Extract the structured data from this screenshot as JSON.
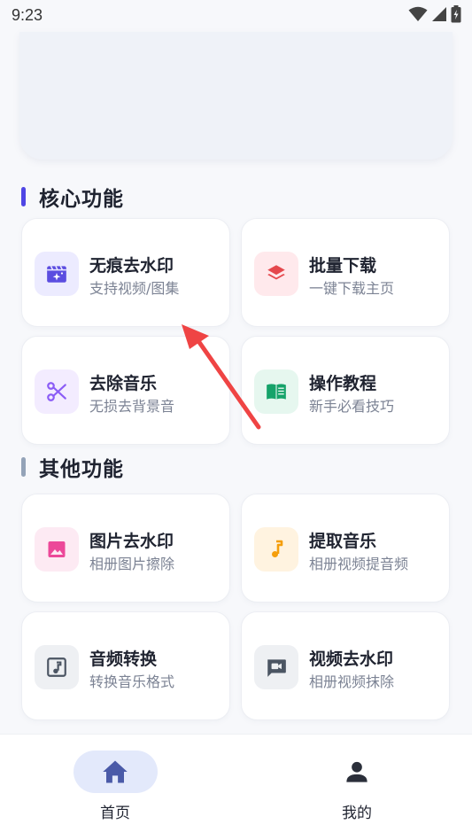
{
  "status_bar": {
    "time": "9:23",
    "icons": [
      "wifi-icon",
      "signal-icon",
      "battery-icon"
    ]
  },
  "sections": {
    "core": {
      "title": "核心功能",
      "accent_color": "#4f46e5"
    },
    "other": {
      "title": "其他功能",
      "accent_color": "#94a3b8"
    }
  },
  "core_cards": [
    {
      "title": "无痕去水印",
      "subtitle": "支持视频/图集",
      "icon": "movie-sparkle-icon",
      "icon_color": "#5b4de0",
      "icon_bg": "#ecebff"
    },
    {
      "title": "批量下载",
      "subtitle": "一键下载主页",
      "icon": "layers-icon",
      "icon_color": "#e5484d",
      "icon_bg": "#ffe9ec"
    },
    {
      "title": "去除音乐",
      "subtitle": "无损去背景音",
      "icon": "scissors-icon",
      "icon_color": "#8b5cf6",
      "icon_bg": "#f3ecff"
    },
    {
      "title": "操作教程",
      "subtitle": "新手必看技巧",
      "icon": "book-icon",
      "icon_color": "#16a36a",
      "icon_bg": "#e6f7ef"
    }
  ],
  "other_cards": [
    {
      "title": "图片去水印",
      "subtitle": "相册图片擦除",
      "icon": "image-icon",
      "icon_color": "#ec4899",
      "icon_bg": "#fdeaf3"
    },
    {
      "title": "提取音乐",
      "subtitle": "相册视频提音频",
      "icon": "music-note-icon",
      "icon_color": "#f59e0b",
      "icon_bg": "#fff3e0"
    },
    {
      "title": "音频转换",
      "subtitle": "转换音乐格式",
      "icon": "audio-file-icon",
      "icon_color": "#4b5563",
      "icon_bg": "#eef0f3"
    },
    {
      "title": "视频去水印",
      "subtitle": "相册视频抹除",
      "icon": "video-chat-icon",
      "icon_color": "#4b5563",
      "icon_bg": "#eef0f3"
    }
  ],
  "bottom_nav": [
    {
      "label": "首页",
      "icon": "home-icon",
      "active": true,
      "icon_color": "#4a5aa8",
      "pill_color": "#e3e9fb"
    },
    {
      "label": "我的",
      "icon": "person-icon",
      "active": false,
      "icon_color": "#2b2f3a"
    }
  ],
  "annotation": {
    "type": "arrow",
    "color": "#ef4444"
  }
}
